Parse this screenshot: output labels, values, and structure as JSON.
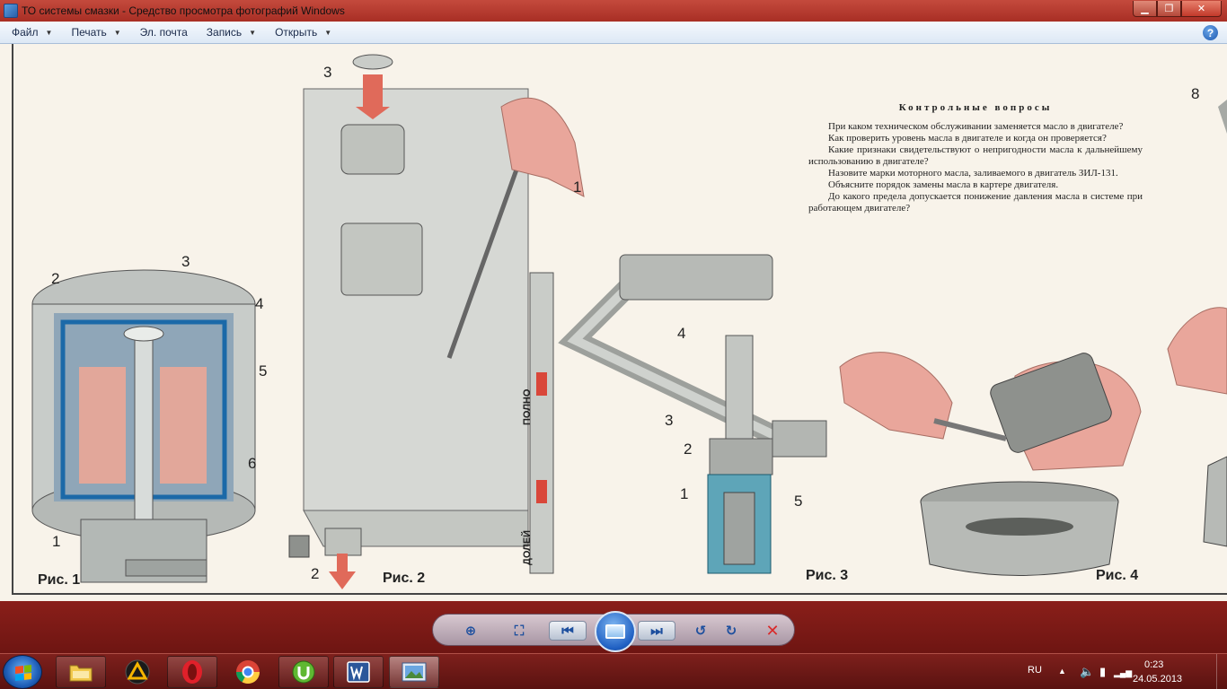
{
  "window": {
    "title": "ТО системы смазки - Средство просмотра фотографий Windows",
    "minimize_glyph": "▁",
    "maximize_glyph": "❐",
    "close_glyph": "✕"
  },
  "menu": {
    "items": [
      {
        "label": "Файл",
        "has_dropdown": true
      },
      {
        "label": "Печать",
        "has_dropdown": true
      },
      {
        "label": "Эл. почта",
        "has_dropdown": false
      },
      {
        "label": "Запись",
        "has_dropdown": true
      },
      {
        "label": "Открыть",
        "has_dropdown": true
      }
    ],
    "dropdown_glyph": "▼",
    "help_glyph": "?"
  },
  "photo": {
    "questions_heading": "Контрольные вопросы",
    "questions": [
      "При каком техническом обслуживании заменяется масло в двигателе?",
      "Как проверить уровень масла в двигателе и когда он проверяется?",
      "Какие признаки свидетельствуют о непригодности масла к дальнейшему использованию в двигателе?",
      "Назовите марки моторного масла, заливаемого в двигатель ЗИЛ-131.",
      "Объясните порядок замены масла в картере двигателя.",
      "До какого предела допускается понижение давления масла в системе при работающем двигателе?"
    ],
    "captions": {
      "fig1": "Рис. 1",
      "fig2": "Рис. 2",
      "fig3": "Рис. 3",
      "fig4": "Рис. 4"
    },
    "dipstick_labels": {
      "full": "ПОЛНО",
      "top_up": "ДОЛЕЙ"
    },
    "callouts": {
      "fig1": [
        "1",
        "2",
        "3",
        "4",
        "5",
        "6"
      ],
      "fig2": [
        "1",
        "2",
        "3"
      ],
      "fig3": [
        "1",
        "2",
        "3",
        "4",
        "5"
      ],
      "fig5": [
        "8"
      ]
    }
  },
  "controls": {
    "zoom_glyph": "⊕",
    "fit_glyph": "⛶",
    "prev_glyph": "⏮",
    "next_glyph": "⏭",
    "rotate_ccw_glyph": "↺",
    "rotate_cw_glyph": "↻",
    "delete_glyph": "✕"
  },
  "taskbar": {
    "language": "RU",
    "time": "0:23",
    "date": "24.05.2013",
    "tray_up_glyph": "▲",
    "volume_glyph": "🔈",
    "battery_glyph": "▮",
    "signal_glyph": "▂▄▆"
  },
  "colors": {
    "window_accent": "#a82e24",
    "taskbar": "#6e1512",
    "photo_background": "#f8f3ea"
  }
}
